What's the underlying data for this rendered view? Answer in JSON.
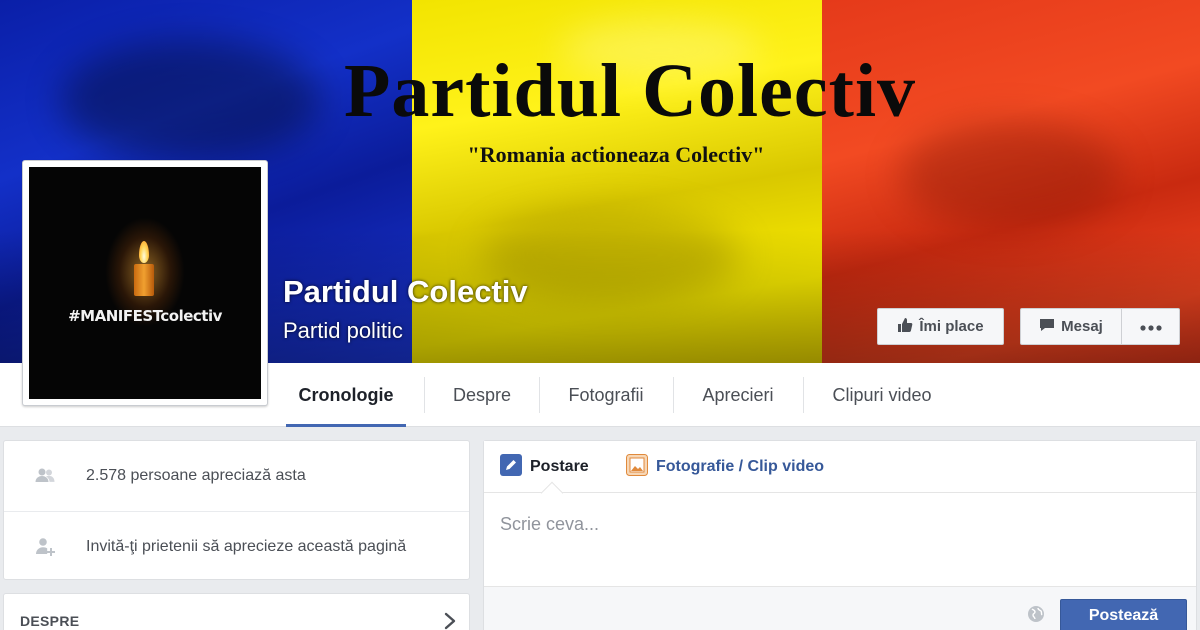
{
  "cover": {
    "title": "Partidul Colectiv",
    "subtitle": "\"Romania actioneaza Colectiv\"",
    "flag_colors": [
      "#1330c8",
      "#f7ea00",
      "#e53a1a"
    ]
  },
  "profile": {
    "hashtag": "#MANIFESTcolectiv"
  },
  "page": {
    "name": "Partidul Colectiv",
    "category": "Partid politic"
  },
  "actions": {
    "like_label": "Îmi place",
    "like_icon": "thumbs-up-icon",
    "message_label": "Mesaj",
    "message_icon": "message-icon",
    "more_icon": "more-dots-icon"
  },
  "tabs": [
    {
      "label": "Cronologie",
      "active": true
    },
    {
      "label": "Despre",
      "active": false
    },
    {
      "label": "Fotografii",
      "active": false
    },
    {
      "label": "Aprecieri",
      "active": false
    },
    {
      "label": "Clipuri video",
      "active": false
    }
  ],
  "sidebar": {
    "likes_text": "2.578 persoane apreciază asta",
    "invite_text": "Invită-ţi prietenii să aprecieze această pagină",
    "about_title": "DESPRE"
  },
  "composer": {
    "post_tab": "Postare",
    "photo_tab": "Fotografie / Clip video",
    "placeholder": "Scrie ceva...",
    "post_button": "Postează",
    "accent": "#4267b2"
  }
}
